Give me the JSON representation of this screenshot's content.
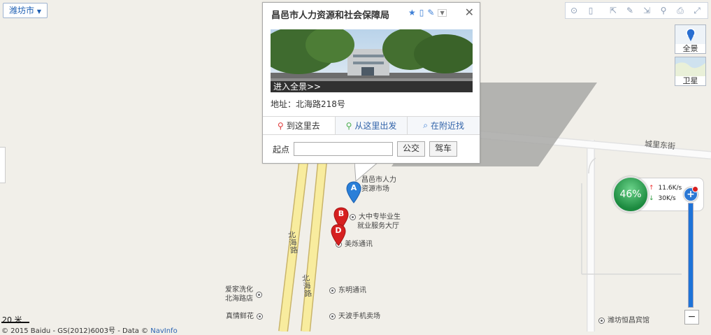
{
  "city_selector": {
    "label": "潍坊市"
  },
  "toolbar": {
    "icons": [
      "ranging-icon",
      "traffic-icon",
      "share-icon",
      "measure-icon",
      "mark-icon",
      "pin-icon",
      "print-icon",
      "fullscreen-icon"
    ]
  },
  "layers": {
    "panorama_label": "全景",
    "satellite_label": "卫星"
  },
  "popup": {
    "title": "昌邑市人力资源和社会保障局",
    "panorama_link": "进入全景>>",
    "address": "地址：北海路218号",
    "tabs": {
      "go_here": "到这里去",
      "from_here": "从这里出发",
      "nearby": "在附近找"
    },
    "route": {
      "start_label": "起点",
      "start_value": "",
      "bus_button": "公交",
      "drive_button": "驾车"
    }
  },
  "markers": [
    {
      "letter": "A",
      "color": "#2a7fd8"
    },
    {
      "letter": "B",
      "color": "#d62020"
    },
    {
      "letter": "D",
      "color": "#d62020"
    }
  ],
  "pois": {
    "a_label_1": "昌邑市人力",
    "a_label_2": "资源市场",
    "b_label_1": "大中专毕业生",
    "b_label_2": "就业服务大厅",
    "meishuo": "美烁通讯",
    "dongming": "东明通讯",
    "aijia_1": "爱家洗化",
    "aijia_2": "北海路店",
    "zhenqing": "真情鲜花",
    "tianbo": "天波手机卖场",
    "hengchang": "潍坊恒昌宾馆"
  },
  "roads": {
    "beihai_1": "北海路",
    "beihai_2": "北海路",
    "chengli_east": "城里东街"
  },
  "network": {
    "percent": "46%",
    "up": "11.6K/s",
    "down": "30K/s"
  },
  "zoom": {
    "minus": "−",
    "plus": "+"
  },
  "scale": "20 米",
  "copyright": {
    "text": "© 2015 Baidu - GS(2012)6003号 - Data © ",
    "link": "NavInfo"
  }
}
